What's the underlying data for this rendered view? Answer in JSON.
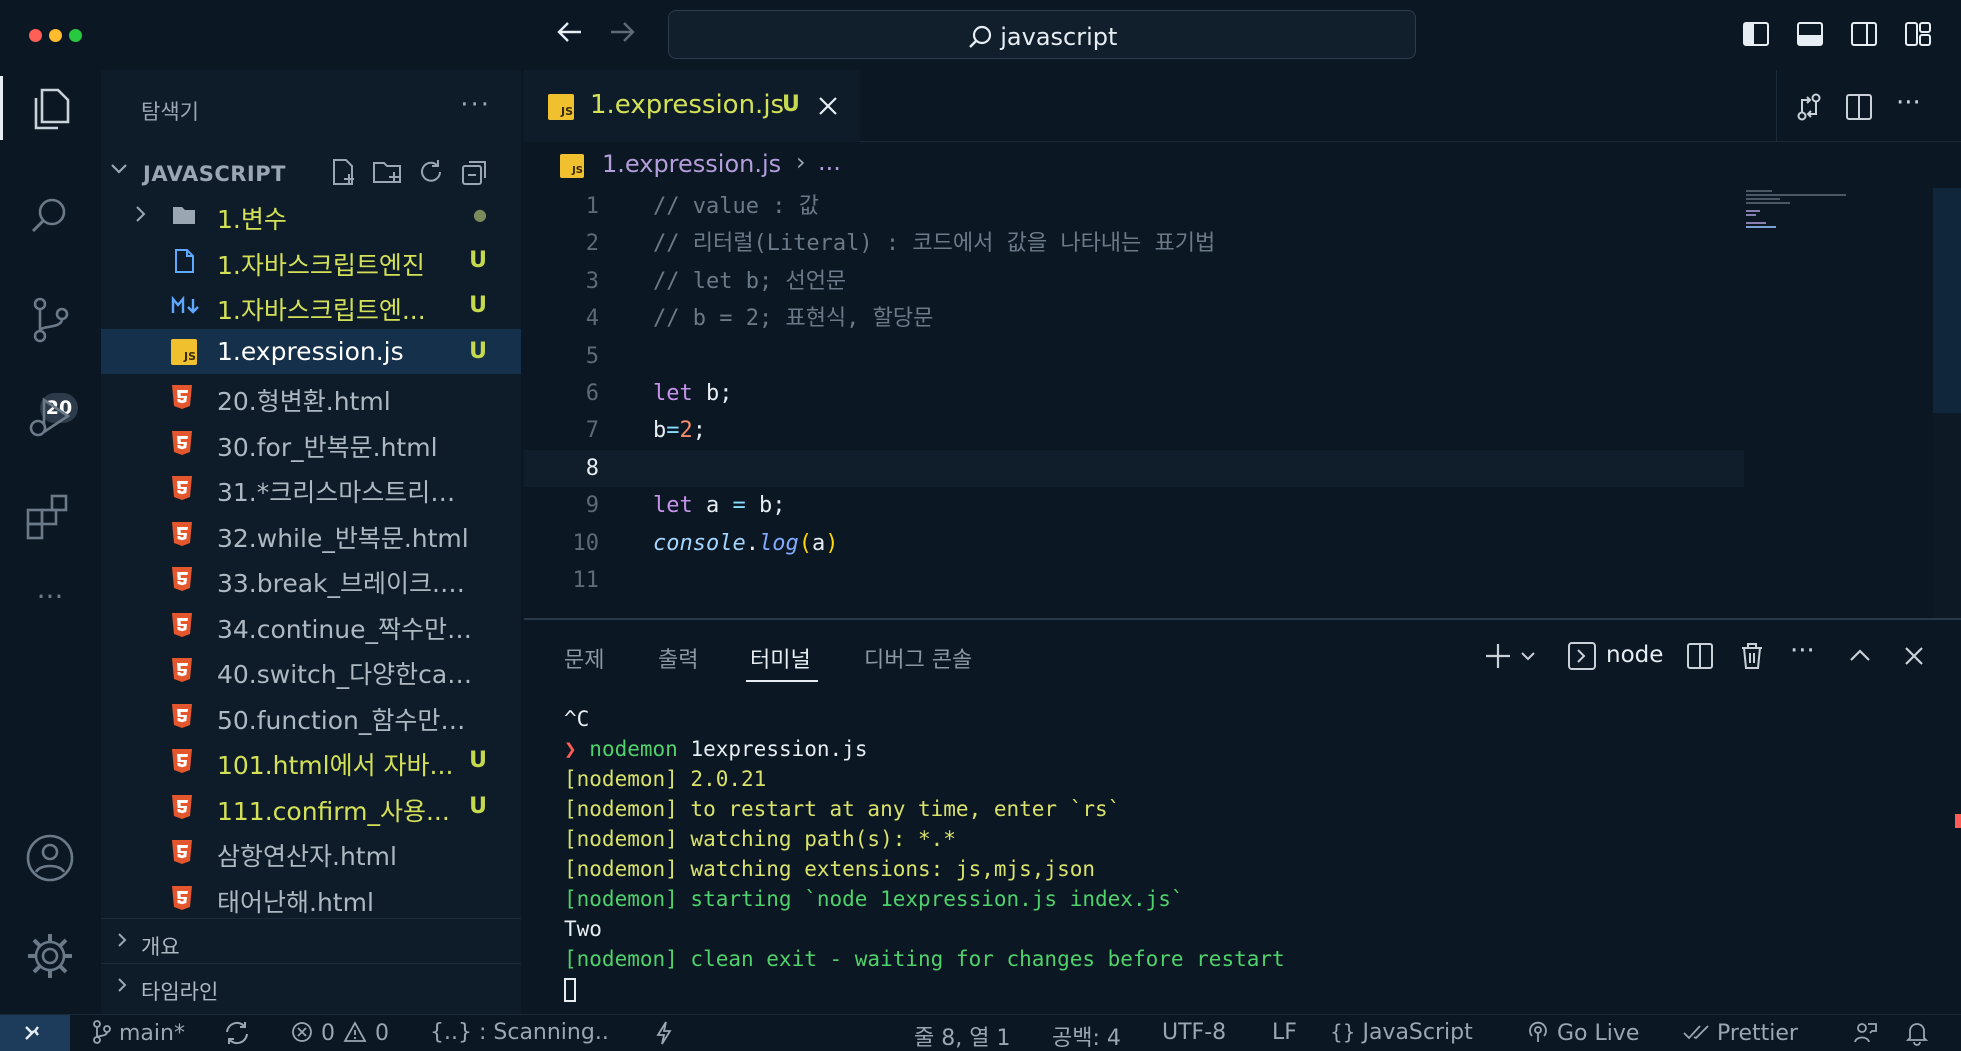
{
  "window": {
    "search_text": "javascript"
  },
  "activity_bar": {
    "source_control_badge": "20"
  },
  "sidebar": {
    "title": "탐색기",
    "more": "···",
    "section_title": "JAVASCRIPT",
    "files": [
      {
        "name": "1.변수",
        "type": "folder",
        "badge": "●",
        "color": "mod"
      },
      {
        "name": "1.자바스크립트엔진",
        "type": "file",
        "badge": "U",
        "color": "mod"
      },
      {
        "name": "1.자바스크립트엔...",
        "type": "markdown",
        "badge": "U",
        "color": "mod"
      },
      {
        "name": "1.expression.js",
        "type": "js",
        "badge": "U",
        "color": "sel"
      },
      {
        "name": "20.형변환.html",
        "type": "html",
        "badge": "",
        "color": "norm"
      },
      {
        "name": "30.for_반복문.html",
        "type": "html",
        "badge": "",
        "color": "norm"
      },
      {
        "name": "31.*크리스마스트리만들...",
        "type": "html",
        "badge": "",
        "color": "norm"
      },
      {
        "name": "32.while_반복문.html",
        "type": "html",
        "badge": "",
        "color": "norm"
      },
      {
        "name": "33.break_브레이크.html",
        "type": "html",
        "badge": "",
        "color": "norm"
      },
      {
        "name": "34.continue_짝수만출...",
        "type": "html",
        "badge": "",
        "color": "norm"
      },
      {
        "name": "40.switch_다양한case....",
        "type": "html",
        "badge": "",
        "color": "norm"
      },
      {
        "name": "50.function_함수만들...",
        "type": "html",
        "badge": "",
        "color": "norm"
      },
      {
        "name": "101.html에서 자바...",
        "type": "html",
        "badge": "U",
        "color": "mod"
      },
      {
        "name": "111.confirm_사용...",
        "type": "html",
        "badge": "U",
        "color": "mod"
      },
      {
        "name": "삼항연산자.html",
        "type": "html",
        "badge": "",
        "color": "norm"
      },
      {
        "name": "태어난해.html",
        "type": "html",
        "badge": "",
        "color": "norm"
      }
    ],
    "outline_label": "개요",
    "timeline_label": "타임라인"
  },
  "editor": {
    "tab_name": "1.expression.js",
    "tab_badge": "U",
    "breadcrumb_file": "1.expression.js",
    "breadcrumb_more": "...",
    "current_line": 8
  },
  "code_lines": [
    {
      "n": "1",
      "parts": [
        [
          "cm",
          "// value : 값"
        ]
      ]
    },
    {
      "n": "2",
      "parts": [
        [
          "cm",
          "// 리터럴(Literal) : 코드에서 값을 나타내는 표기법"
        ]
      ]
    },
    {
      "n": "3",
      "parts": [
        [
          "cm",
          "// let b; 선언문"
        ]
      ]
    },
    {
      "n": "4",
      "parts": [
        [
          "cm",
          "// b = 2; 표현식, 할당문"
        ]
      ]
    },
    {
      "n": "5",
      "parts": []
    },
    {
      "n": "6",
      "parts": [
        [
          "kw",
          "let"
        ],
        [
          "wh",
          " b;"
        ]
      ]
    },
    {
      "n": "7",
      "parts": [
        [
          "wh",
          "b"
        ],
        [
          "op",
          "="
        ],
        [
          "num",
          "2"
        ],
        [
          "wh",
          ";"
        ]
      ]
    },
    {
      "n": "8",
      "parts": []
    },
    {
      "n": "9",
      "parts": [
        [
          "kw",
          "let"
        ],
        [
          "wh",
          " a "
        ],
        [
          "op",
          "="
        ],
        [
          "wh",
          " b;"
        ]
      ]
    },
    {
      "n": "10",
      "parts": [
        [
          "it",
          "console"
        ],
        [
          "wh",
          "."
        ],
        [
          "fn",
          "log"
        ],
        [
          "br",
          "("
        ],
        [
          "wh",
          "a"
        ],
        [
          "br",
          ")"
        ]
      ]
    },
    {
      "n": "11",
      "parts": []
    }
  ],
  "panel": {
    "tabs": [
      "문제",
      "출력",
      "터미널",
      "디버그 콘솔"
    ],
    "active_tab": "터미널",
    "terminal_name": "node"
  },
  "terminal_lines": [
    [
      [
        "t-white",
        "^C"
      ]
    ],
    [
      [
        "t-red",
        "❯ "
      ],
      [
        "t-green",
        "nodemon"
      ],
      [
        "t-white",
        " 1expression.js"
      ]
    ],
    [
      [
        "t-yellow",
        "[nodemon] 2.0.21"
      ]
    ],
    [
      [
        "t-yellow",
        "[nodemon] to restart at any time, enter `rs`"
      ]
    ],
    [
      [
        "t-yellow",
        "[nodemon] watching path(s): *.*"
      ]
    ],
    [
      [
        "t-yellow",
        "[nodemon] watching extensions: js,mjs,json"
      ]
    ],
    [
      [
        "t-green",
        "[nodemon] starting `node 1expression.js index.js`"
      ]
    ],
    [
      [
        "t-white",
        "Two"
      ]
    ],
    [
      [
        "t-green",
        "[nodemon] clean exit - waiting for changes before restart"
      ]
    ]
  ],
  "status_bar": {
    "branch": "main*",
    "errors": "0",
    "warnings": "0",
    "scanning": "{..} : Scanning..",
    "position": "줄 8, 열 1",
    "spaces": "공백: 4",
    "encoding": "UTF-8",
    "eol": "LF",
    "language": "JavaScript",
    "go_live": "Go Live",
    "prettier": "Prettier"
  },
  "colors": {
    "background": "#0b1722",
    "sidebar": "#0e1c29",
    "modified": "#d4e157",
    "selected_row": "#15304a",
    "terminal_green": "#4fd16b",
    "terminal_yellow": "#d9e26a"
  }
}
